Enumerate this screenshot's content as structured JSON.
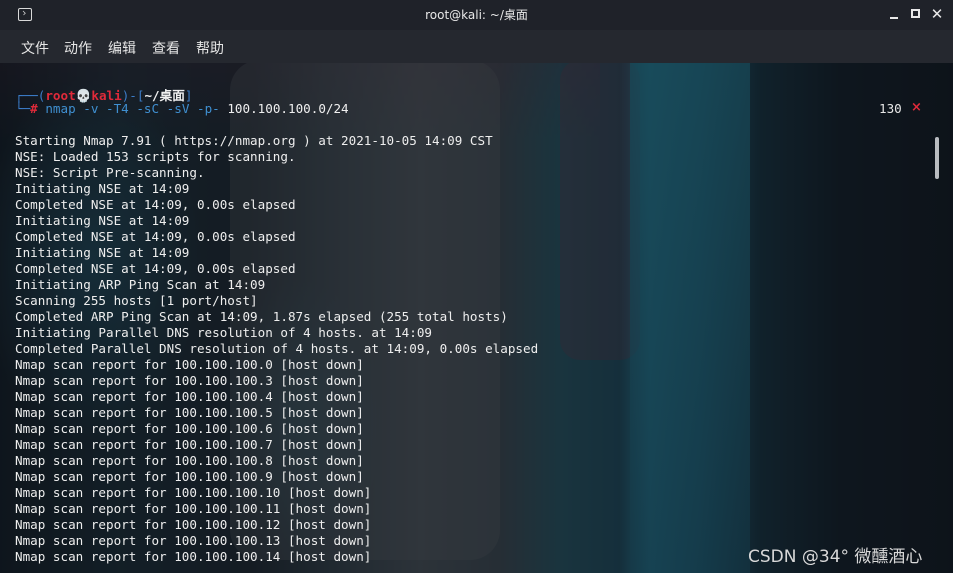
{
  "window": {
    "title": "root@kali: ~/桌面",
    "controls": [
      "minimize-icon",
      "maximize-icon",
      "close-icon"
    ]
  },
  "menu": {
    "file": "文件",
    "action": "动作",
    "edit": "编辑",
    "view": "查看",
    "help": "帮助"
  },
  "prompt": {
    "open_bracket": "┌──(",
    "user": "root",
    "skull": "💀",
    "host": "kali",
    "mid": ")-[",
    "dir": "~/桌面",
    "close_bracket": "]",
    "line2_prefix": "└─",
    "hash": "#",
    "command": " nmap -v -T4 -sC -sV -p- ",
    "target": "100.100.100.0/24",
    "exit_code": "130",
    "exit_mark": "×"
  },
  "output": [
    "Starting Nmap 7.91 ( https://nmap.org ) at 2021-10-05 14:09 CST",
    "NSE: Loaded 153 scripts for scanning.",
    "NSE: Script Pre-scanning.",
    "Initiating NSE at 14:09",
    "Completed NSE at 14:09, 0.00s elapsed",
    "Initiating NSE at 14:09",
    "Completed NSE at 14:09, 0.00s elapsed",
    "Initiating NSE at 14:09",
    "Completed NSE at 14:09, 0.00s elapsed",
    "Initiating ARP Ping Scan at 14:09",
    "Scanning 255 hosts [1 port/host]",
    "Completed ARP Ping Scan at 14:09, 1.87s elapsed (255 total hosts)",
    "Initiating Parallel DNS resolution of 4 hosts. at 14:09",
    "Completed Parallel DNS resolution of 4 hosts. at 14:09, 0.00s elapsed",
    "Nmap scan report for 100.100.100.0 [host down]",
    "Nmap scan report for 100.100.100.3 [host down]",
    "Nmap scan report for 100.100.100.4 [host down]",
    "Nmap scan report for 100.100.100.5 [host down]",
    "Nmap scan report for 100.100.100.6 [host down]",
    "Nmap scan report for 100.100.100.7 [host down]",
    "Nmap scan report for 100.100.100.8 [host down]",
    "Nmap scan report for 100.100.100.9 [host down]",
    "Nmap scan report for 100.100.100.10 [host down]",
    "Nmap scan report for 100.100.100.11 [host down]",
    "Nmap scan report for 100.100.100.12 [host down]",
    "Nmap scan report for 100.100.100.13 [host down]",
    "Nmap scan report for 100.100.100.14 [host down]"
  ],
  "watermark": "CSDN @34° 微醺酒心",
  "colors": {
    "prompt_frame": "#3b7cc7",
    "prompt_user": "#e02a3a",
    "output_text": "#eeeeee",
    "titlebar": "#1f2229",
    "menubar": "#25282f"
  }
}
